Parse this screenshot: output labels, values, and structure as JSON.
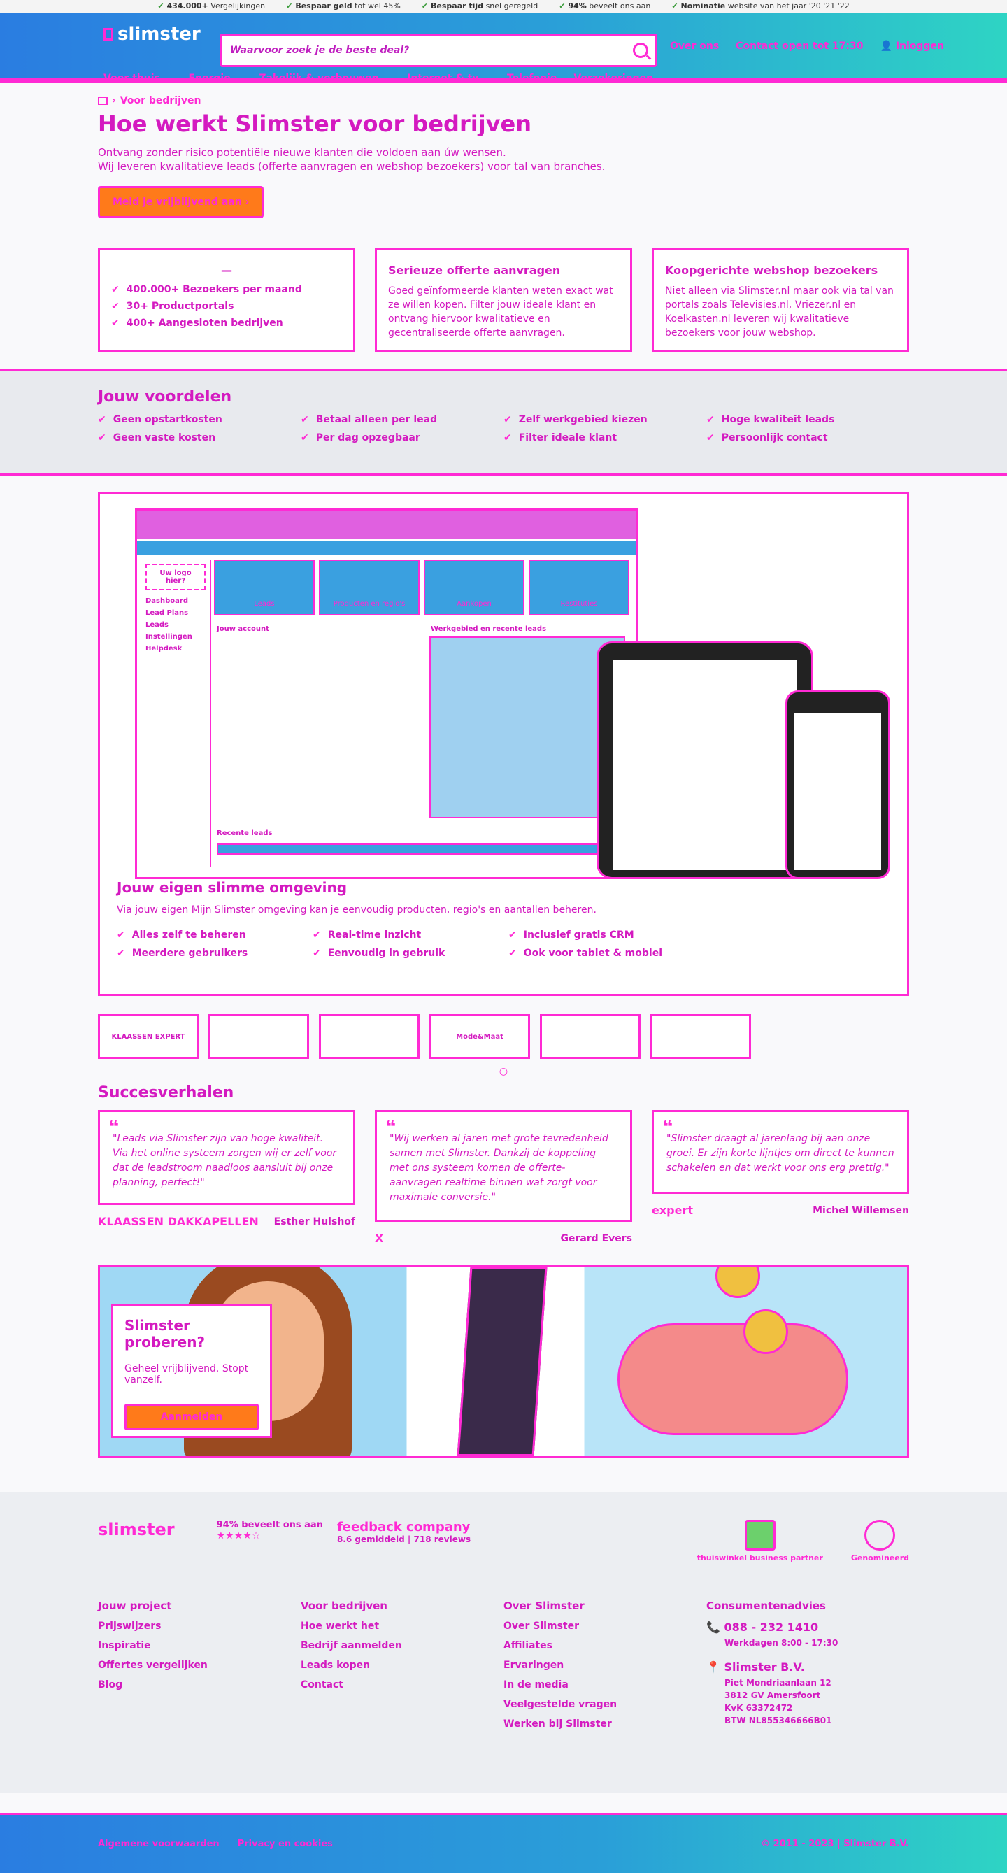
{
  "usp": [
    {
      "bold": "434.000+",
      "text": "Vergelijkingen"
    },
    {
      "bold": "Bespaar geld",
      "text": "tot wel 45%"
    },
    {
      "bold": "Bespaar tijd",
      "text": "snel geregeld"
    },
    {
      "bold": "94%",
      "text": "beveelt ons aan"
    },
    {
      "bold": "Nominatie",
      "text": "website van het jaar '20 '21 '22"
    }
  ],
  "header": {
    "logo": "slimster",
    "search_placeholder": "Waarvoor zoek je de beste deal?",
    "links": [
      "Over ons",
      "Contact open tot 17:30",
      "Inloggen"
    ],
    "nav": [
      "Voor thuis ⌄",
      "Energie ⌄",
      "Zakelijk & verbouwen ⌄",
      "Internet & tv ⌄",
      "Telefonie",
      "Verzekeringen"
    ]
  },
  "breadcrumb": "Voor bedrijven",
  "hero": {
    "title": "Hoe werkt Slimster voor bedrijven",
    "line1": "Ontvang zonder risico potentiële nieuwe klanten die voldoen aan úw wensen.",
    "line2": "Wij leveren kwalitatieve leads (offerte aanvragen en webshop bezoekers) voor tal van branches.",
    "cta": "Meld je vrijblijvend aan ›"
  },
  "cards": [
    {
      "title": "—",
      "items": [
        "400.000+ Bezoekers per maand",
        "30+ Productportals",
        "400+ Aangesloten bedrijven"
      ]
    },
    {
      "title": "Serieuze offerte aanvragen",
      "text": "Goed geïnformeerde klanten weten exact wat ze willen kopen. Filter jouw ideale klant en ontvang hiervoor kwalitatieve en gecentraliseerde offerte aanvragen."
    },
    {
      "title": "Koopgerichte webshop bezoekers",
      "text": "Niet alleen via Slimster.nl maar ook via tal van portals zoals Televisies.nl, Vriezer.nl en Koelkasten.nl leveren wij kwalitatieve bezoekers voor jouw webshop."
    }
  ],
  "benefits": {
    "title": "Jouw voordelen",
    "items": [
      "Geen opstartkosten",
      "Betaal alleen per lead",
      "Zelf werkgebied kiezen",
      "Hoge kwaliteit leads",
      "Geen vaste kosten",
      "Per dag opzegbaar",
      "Filter ideale klant",
      "Persoonlijk contact"
    ]
  },
  "env": {
    "title": "Jouw eigen slimme omgeving",
    "text": "Via jouw eigen Mijn Slimster omgeving kan je eenvoudig producten, regio's en aantallen beheren.",
    "items": [
      "Alles zelf te beheren",
      "Real-time inzicht",
      "Inclusief gratis CRM",
      "",
      "Meerdere gebruikers",
      "Eenvoudig in gebruik",
      "Ook voor tablet & mobiel",
      ""
    ],
    "screen": {
      "side": [
        "Uw logo hier?",
        "Dashboard",
        "Lead Plans",
        "Leads",
        "Instellingen",
        "Helpdesk"
      ],
      "tiles": [
        "Leads",
        "Producten en regio's",
        "Aankopen",
        "Restituties"
      ],
      "account": "Jouw account",
      "map": "Werkgebied en recente leads",
      "recent": "Recente leads"
    }
  },
  "logos": [
    "KLAASSEN EXPERT",
    "",
    "",
    "Mode&Maat",
    "",
    ""
  ],
  "stories": {
    "title": "Succesverhalen",
    "items": [
      {
        "quote": "\"Leads via Slimster zijn van hoge kwaliteit. Via het online systeem zorgen wij er zelf voor dat de leadstroom naadloos aansluit bij onze planning, perfect!\"",
        "name": "Esther Hulshof",
        "company": "KLAASSEN DAKKAPELLEN"
      },
      {
        "quote": "\"Wij werken al jaren met grote tevredenheid samen met Slimster. Dankzij de koppeling met ons systeem komen de offerte-aanvragen realtime binnen wat zorgt voor maximale conversie.\"",
        "name": "Gerard Evers",
        "company": "X"
      },
      {
        "quote": "\"Slimster draagt al jarenlang bij aan onze groei. Er zijn korte lijntjes om direct te kunnen schakelen en dat werkt voor ons erg prettig.\"",
        "name": "Michel Willemsen",
        "company": "expert"
      }
    ]
  },
  "banner": {
    "title": "Slimster proberen?",
    "text": "Geheel vrijblijvend. Stopt vanzelf.",
    "button": "Aanmelden"
  },
  "footer": {
    "logo": "slimster",
    "recommend": "94% beveelt ons aan",
    "stars": "★★★★☆",
    "feedback": "feedback company",
    "score": "8.6 gemiddeld | 718 reviews",
    "badge1": "thuiswinkel business partner",
    "badge2": "Genomineerd",
    "cols": [
      {
        "title": "Jouw project",
        "links": [
          "Prijswijzers",
          "Inspiratie",
          "Offertes vergelijken",
          "Blog"
        ]
      },
      {
        "title": "Voor bedrijven",
        "links": [
          "Hoe werkt het",
          "Bedrijf aanmelden",
          "Leads kopen",
          "Contact"
        ]
      },
      {
        "title": "Over Slimster",
        "links": [
          "Over Slimster",
          "Affiliates",
          "Ervaringen",
          "In de media",
          "Veelgestelde vragen",
          "Werken bij Slimster"
        ]
      },
      {
        "title": "Consumentenadvies",
        "phone": "088 - 232 1410",
        "hours": "Werkdagen 8:00 - 17:30",
        "company": "Slimster B.V.",
        "addr": [
          "Piet Mondriaanlaan 12",
          "3812 GV Amersfoort",
          "KvK 63372472",
          "BTW NL855346666B01"
        ]
      }
    ]
  },
  "bottom": {
    "links": [
      "Algemene voorwaarden",
      "Privacy en cookies"
    ],
    "copy": "© 2011 - 2023 | Slimster B.V."
  }
}
